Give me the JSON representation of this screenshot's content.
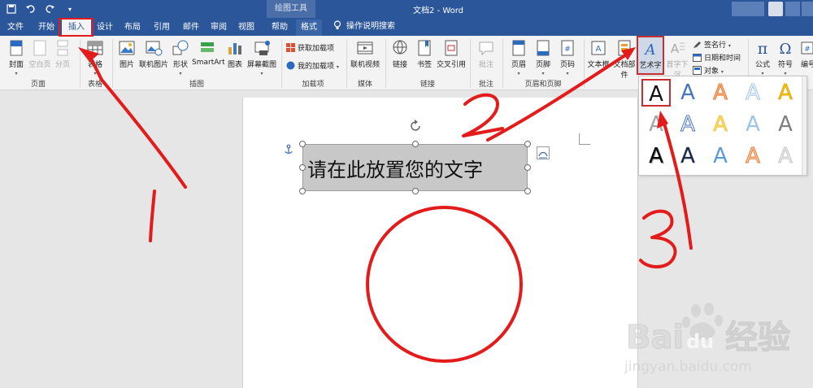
{
  "title": {
    "context_tools": "绘图工具",
    "document": "文档2 - Word"
  },
  "tabs": [
    {
      "label": "文件"
    },
    {
      "label": "开始"
    },
    {
      "label": "插入"
    },
    {
      "label": "设计"
    },
    {
      "label": "布局"
    },
    {
      "label": "引用"
    },
    {
      "label": "邮件"
    },
    {
      "label": "审阅"
    },
    {
      "label": "视图"
    },
    {
      "label": "帮助"
    },
    {
      "label": "格式"
    }
  ],
  "tellme": "操作说明搜索",
  "ribbon": {
    "pages": {
      "label": "页面",
      "cover": "封面",
      "blank": "空白页",
      "break": "分页"
    },
    "tables": {
      "label": "表格",
      "table": "表格"
    },
    "illustrations": {
      "label": "插图",
      "picture": "图片",
      "online_picture": "联机图片",
      "shapes": "形状",
      "smartart": "SmartArt",
      "chart": "图表",
      "screenshot": "屏幕截图"
    },
    "addins": {
      "label": "加载项",
      "get": "获取加载项",
      "mine": "我的加载项"
    },
    "media": {
      "label": "媒体",
      "video": "联机视频"
    },
    "links": {
      "label": "链接",
      "link": "链接",
      "bookmark": "书签",
      "crossref": "交叉引用"
    },
    "comments": {
      "label": "批注",
      "comment": "批注"
    },
    "header_footer": {
      "label": "页眉和页脚",
      "header": "页眉",
      "footer": "页脚",
      "page_number": "页码"
    },
    "text": {
      "textbox": "文本框",
      "quickparts": "文档部件",
      "wordart": "艺术字",
      "dropcap": "首字下沉",
      "signature": "签名行",
      "datetime": "日期和时间",
      "object": "对象"
    },
    "symbols": {
      "equation": "公式",
      "symbol": "符号",
      "number": "编号"
    }
  },
  "document": {
    "textbox_text": "请在此放置您的文字"
  },
  "gallery": {
    "glyph": "A"
  },
  "annotations": {
    "one": "1",
    "two": "2",
    "three": "3"
  },
  "watermark": {
    "brand": "Bai",
    "brand2": "du",
    "cn": "经验",
    "url": "jingyan.baidu.com"
  },
  "colors": {
    "titlebar": "#2b579a",
    "ribbon": "#f3f3f3",
    "annotation_red": "#e31b1b",
    "circle_red": "#e31b1b"
  }
}
